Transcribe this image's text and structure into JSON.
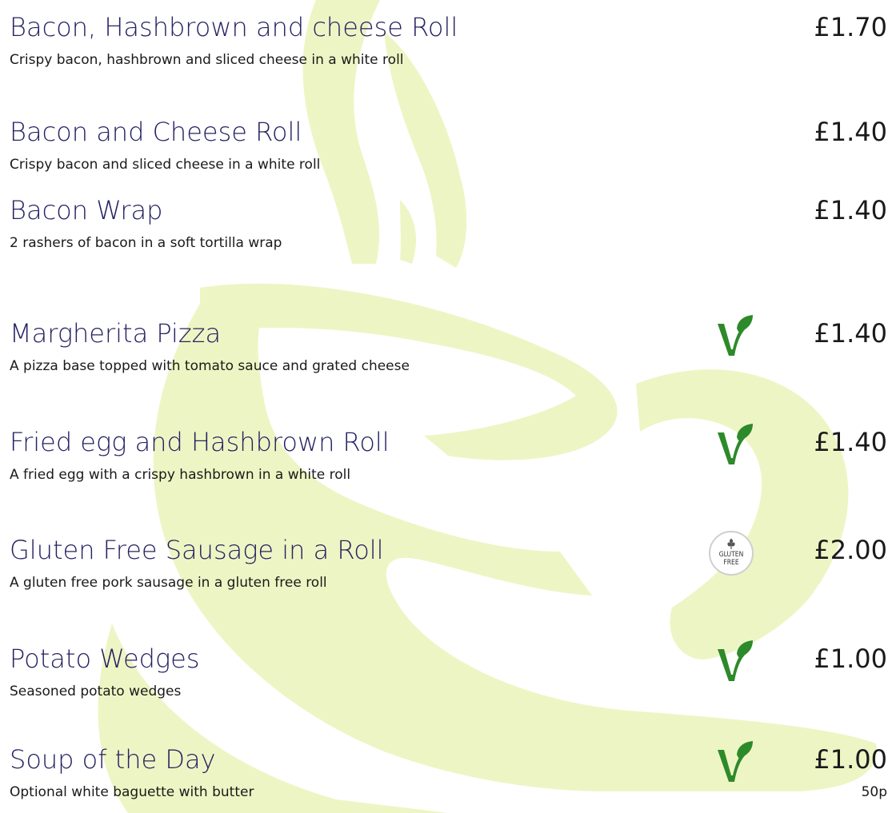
{
  "colors": {
    "background_shape": "#EEF5C4",
    "title": "#262262",
    "text": "#1A1A1A",
    "vegetarian_icon": "#2D8A2A"
  },
  "menu": {
    "items": [
      {
        "name": "Bacon, Hashbrown and cheese Roll",
        "price": "£1.70",
        "description": "Crispy bacon, hashbrown and sliced cheese in a white roll",
        "badge": "none"
      },
      {
        "name": "Bacon and Cheese Roll",
        "price": "£1.40",
        "description": "Crispy bacon and sliced cheese in a white roll",
        "badge": "none"
      },
      {
        "name": "Bacon Wrap",
        "price": "£1.40",
        "description": "2 rashers of bacon in a soft tortilla wrap",
        "badge": "none"
      },
      {
        "name": "Margherita Pizza",
        "price": "£1.40",
        "description": "A pizza base topped with tomato sauce and grated cheese",
        "badge": "vegetarian-leaf-icon"
      },
      {
        "name": "Fried egg and Hashbrown Roll",
        "price": "£1.40",
        "description": "A fried egg with a crispy hashbrown in a white roll",
        "badge": "vegetarian-leaf-icon"
      },
      {
        "name": "Gluten Free Sausage in a Roll",
        "price": "£2.00",
        "description": "A gluten free pork sausage in a gluten free roll",
        "badge": "gluten-free-icon",
        "badge_text": [
          "GLUTEN",
          "FREE"
        ]
      },
      {
        "name": "Potato Wedges",
        "price": "£1.00",
        "description": "Seasoned potato wedges",
        "badge": "vegetarian-leaf-icon"
      },
      {
        "name": "Soup of the Day",
        "price": "£1.00",
        "description": "Optional white baguette with butter",
        "extra_price": "50p",
        "badge": "vegetarian-leaf-icon"
      }
    ]
  }
}
